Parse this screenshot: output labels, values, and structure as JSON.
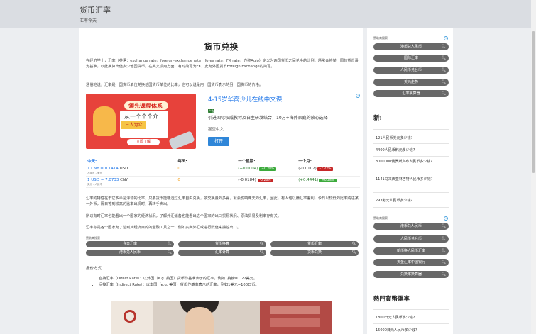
{
  "header": {
    "title": "货币汇率",
    "subtitle": "汇率今天"
  },
  "main": {
    "title": "货币兑换",
    "intro": "在经济学上，汇率（英语：exchange rate，foreign-exchange rate，forex rate，FX rate，亦称Agio）定义为两国货币之间兑换的比例，通常会将某一国的货币设为基准，以此换算出值多少他国货币。在英文惯用方面，有时简写为FX，此为外国货币Foreign Exchange的简写。",
    "intro2": "通俗地说，汇率是一国货币单位兑换他国货币单位的比率，也可以说是用一国货币表示的另一国货币的价格。",
    "ad": {
      "image_headline": "领先课程体系",
      "image_board": "从一个个个介",
      "image_board2": "三人为众",
      "image_cta": "立即了解",
      "title": "4-15岁华裔少儿在线中文课",
      "badge": "广告",
      "desc": "引进国际权威教材及自主研发结合，10万+海外家庭的放心选择",
      "source": "猩空中文",
      "button": "打开",
      "info": "i"
    },
    "rates": {
      "headers": [
        "今天:",
        "每天:",
        "一个星期:",
        "一个月:"
      ],
      "rows": [
        {
          "amount": "1 CNY = ",
          "value": "0.1414",
          "unit": " USD",
          "sub": "人民币 - 美元",
          "daily": "0",
          "week_diff": "(+0.0004)",
          "week_pct": "+0.28%",
          "month_diff": "(-0.0102)",
          "month_pct": "-7.22%"
        },
        {
          "amount": "1 USD = ",
          "value": "7.0733",
          "unit": " CNY",
          "sub": "美元 - 人民币",
          "daily": "0",
          "week_diff": "(-0.0184)",
          "week_pct": "-0.26%",
          "month_diff": "(+0.4441)",
          "month_pct": "+6.28%"
        }
      ]
    },
    "para3": "汇率的特性在于它多半是浮动的比率，只要货币能够透过汇率自由兑换，依交换量的多寡，就会影响两天的汇率，因此，有人也以赚汇率差利，今日以较低的比率购进某一外币，隔日等到较高的比率出现时，再转手卖出。",
    "para4": "所以有时汇率也能看出一个国家的经济状况，了解外汇储备也能看出这个国家的出口贸易状况、原油贸易及利率存有关。",
    "para5": "汇率亦是各个国家为了达到其经济目的的金融工具之一，例如买卖外汇或进行贬值来操控出口。",
    "search_header": "赞助商搜索",
    "search_buttons": [
      "今日汇率",
      "货币换算",
      "货币汇率",
      "港币兑人民币",
      "汇率计算",
      "货币兑换"
    ],
    "list_label": "报价方式：",
    "list": [
      "直接汇率（Direct Rate）：以外国（e.g. 英国）货币作基准表示的汇率，例如1英镑=1.27美元。",
      "间接汇率（Indirect Rate）：以本国（e.g. 美国）货币作基准表示的汇率，例如1美元=100日币。"
    ]
  },
  "sidebar": {
    "search_header": "赞助商搜索",
    "info": "i",
    "search_top": [
      "港币兑人民币",
      "国际汇率",
      "人民币兑台币",
      "美元走势",
      "汇率换算器"
    ],
    "new_heading": "新:",
    "new_links": [
      "121人民币美元多少钱?",
      "4400人民币韩元多少钱?",
      "8000000俄罗斯卢布人民币多少钱?",
      "1141马来西亚林吉特人民币多少钱?",
      "293港元人民币多少钱?"
    ],
    "search_bottom": [
      "港币兑人民币",
      "人民币兑台币",
      "新币换人民币汇率",
      "美金汇率中国银行",
      "兑换率换算器"
    ],
    "popular_heading": "熱門貨幣匯率",
    "popular_links": [
      "1800日元人民币多少钱?",
      "15000日元人民币多少钱?"
    ]
  },
  "icons": {
    "search": "search-icon"
  },
  "colors": {
    "accent": "#1a73e8",
    "button": "#686868",
    "up": "#3caa3c",
    "down": "#c62828",
    "zero": "#f39c12"
  }
}
